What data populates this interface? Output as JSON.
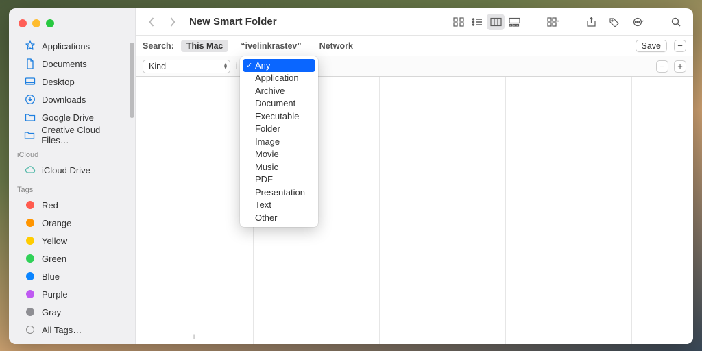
{
  "window": {
    "title": "New Smart Folder"
  },
  "sidebar": {
    "favorites": [
      {
        "label": "Applications",
        "icon": "applications"
      },
      {
        "label": "Documents",
        "icon": "document"
      },
      {
        "label": "Desktop",
        "icon": "desktop"
      },
      {
        "label": "Downloads",
        "icon": "downloads"
      },
      {
        "label": "Google Drive",
        "icon": "folder"
      },
      {
        "label": "Creative Cloud Files…",
        "icon": "folder"
      }
    ],
    "icloud_header": "iCloud",
    "icloud_items": [
      {
        "label": "iCloud Drive",
        "icon": "cloud"
      }
    ],
    "tags_header": "Tags",
    "tags": [
      {
        "label": "Red",
        "color": "#ff5b4f"
      },
      {
        "label": "Orange",
        "color": "#ff9500"
      },
      {
        "label": "Yellow",
        "color": "#ffcc00"
      },
      {
        "label": "Green",
        "color": "#30d158"
      },
      {
        "label": "Blue",
        "color": "#0a84ff"
      },
      {
        "label": "Purple",
        "color": "#bf5af2"
      },
      {
        "label": "Gray",
        "color": "#8e8e93"
      }
    ],
    "all_tags": "All Tags…"
  },
  "scopebar": {
    "label": "Search:",
    "scopes": [
      {
        "label": "This Mac",
        "selected": true
      },
      {
        "label": "“ivelinkrastev”",
        "selected": false
      },
      {
        "label": "Network",
        "selected": false
      }
    ],
    "save_label": "Save"
  },
  "criteria": {
    "attribute": "Kind",
    "value_selected": "Any",
    "options": [
      "Any",
      "Application",
      "Archive",
      "Document",
      "Executable",
      "Folder",
      "Image",
      "Movie",
      "Music",
      "PDF",
      "Presentation",
      "Text",
      "Other"
    ]
  }
}
